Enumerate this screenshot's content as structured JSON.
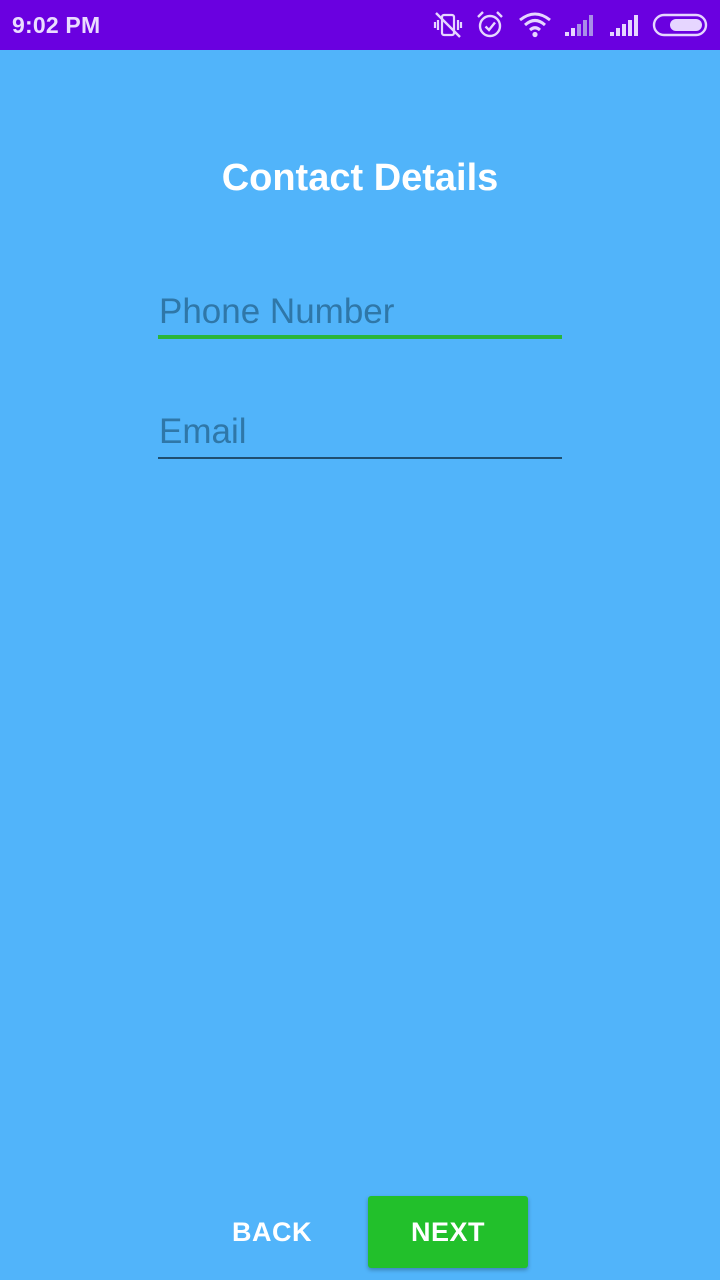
{
  "status_bar": {
    "time": "9:02 PM",
    "icons": [
      "vibrate-off-icon",
      "alarm-icon",
      "wifi-icon",
      "signal-weak-icon",
      "signal-icon",
      "battery-icon"
    ],
    "background": "#6a00e0"
  },
  "screen": {
    "title": "Contact Details",
    "background": "#51b4fa"
  },
  "form": {
    "phone": {
      "placeholder": "Phone Number",
      "value": "",
      "focused": true,
      "accent": "#2bb63a"
    },
    "email": {
      "placeholder": "Email",
      "value": ""
    }
  },
  "actions": {
    "back_label": "BACK",
    "next_label": "NEXT",
    "next_color": "#22c02b"
  }
}
